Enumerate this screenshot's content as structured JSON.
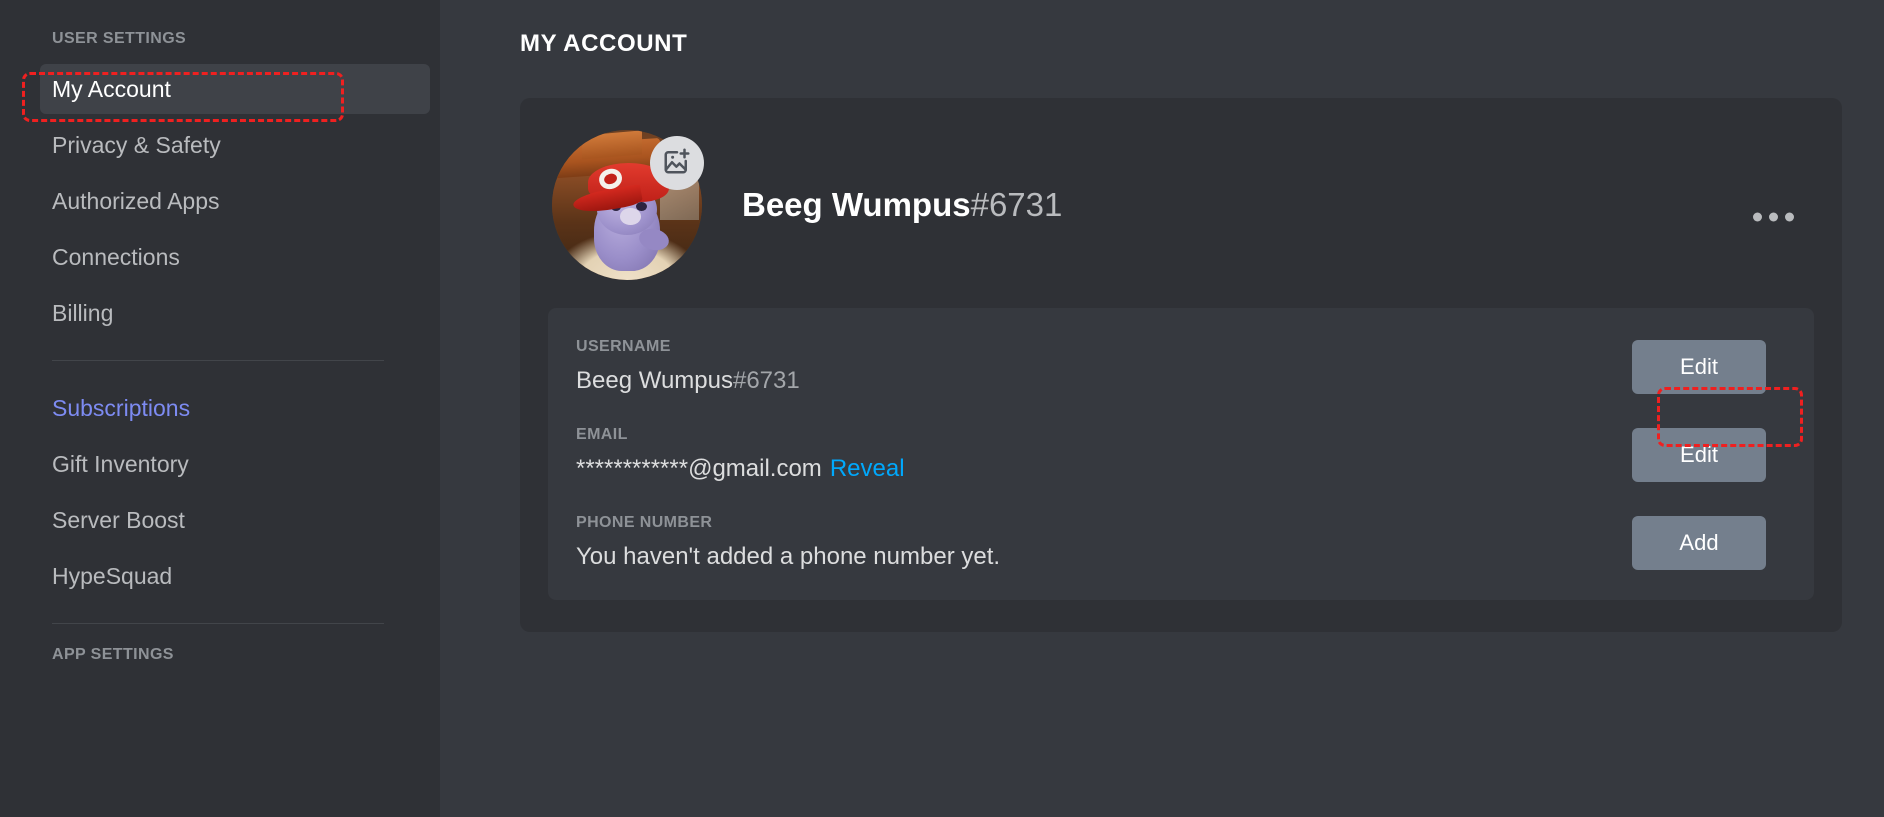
{
  "sidebar": {
    "user_settings_header": "USER SETTINGS",
    "app_settings_header": "APP SETTINGS",
    "items": [
      {
        "label": "My Account",
        "selected": true
      },
      {
        "label": "Privacy & Safety",
        "selected": false
      },
      {
        "label": "Authorized Apps",
        "selected": false
      },
      {
        "label": "Connections",
        "selected": false
      },
      {
        "label": "Billing",
        "selected": false
      },
      {
        "label": "Subscriptions",
        "selected": false,
        "accent": true
      },
      {
        "label": "Gift Inventory",
        "selected": false
      },
      {
        "label": "Server Boost",
        "selected": false
      },
      {
        "label": "HypeSquad",
        "selected": false
      }
    ]
  },
  "main": {
    "page_title": "MY ACCOUNT",
    "profile": {
      "display_name": "Beeg Wumpus",
      "discriminator": "#6731",
      "avatar_badge_icon": "image-plus-icon",
      "more_options_icon": "more-horizontal-icon"
    },
    "fields": {
      "username": {
        "label": "USERNAME",
        "value_name": "Beeg Wumpus",
        "value_discriminator": "#6731",
        "button_label": "Edit"
      },
      "email": {
        "label": "EMAIL",
        "masked_value": "************",
        "domain": "@gmail.com",
        "reveal_label": "Reveal",
        "button_label": "Edit"
      },
      "phone": {
        "label": "PHONE NUMBER",
        "value": "You haven't added a phone number yet.",
        "button_label": "Add"
      }
    }
  },
  "colors": {
    "sidebar_bg": "#2f3136",
    "main_bg": "#36393f",
    "card_bg": "#2f3136",
    "panel_bg": "#36393f",
    "accent_blurple": "#7d8bf2",
    "link_blue": "#00a8fc",
    "button_gray": "#747f8d",
    "annotation_red": "#ef2020",
    "muted_text": "#8e9297",
    "body_text": "#dcddde"
  }
}
